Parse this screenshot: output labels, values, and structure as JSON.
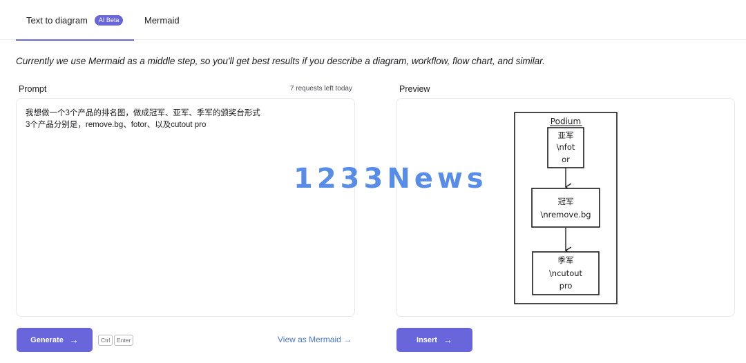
{
  "tabs": {
    "text_to_diagram": "Text to diagram",
    "ai_badge": "AI Beta",
    "mermaid": "Mermaid"
  },
  "description": "Currently we use Mermaid as a middle step, so you'll get best results if you describe a diagram, workflow, flow chart, and similar.",
  "prompt": {
    "label": "Prompt",
    "requests_left": "7 requests left today",
    "lines": [
      "我想做一个3个产品的排名图，做成冠军、亚军、季军的颁奖台形式",
      "3个产品分别是，remove.bg、fotor、以及cutout pro"
    ]
  },
  "preview": {
    "label": "Preview",
    "diagram": {
      "container_title": "Podium",
      "nodes": [
        {
          "lines": [
            "亚军",
            "\\nfot",
            "or"
          ]
        },
        {
          "lines": [
            "冠军",
            "\\nremove.bg"
          ]
        },
        {
          "lines": [
            "季军",
            "\\ncutout",
            "pro"
          ]
        }
      ]
    }
  },
  "actions": {
    "generate_label": "Generate",
    "generate_arrow": "→",
    "kbd_ctrl": "Ctrl",
    "kbd_enter": "Enter",
    "view_mermaid_label": "View as Mermaid →",
    "insert_label": "Insert",
    "insert_arrow": "→"
  },
  "watermark": "1233News",
  "colors": {
    "accent": "#6965db",
    "link": "#4a76d1",
    "watermark": "#4f86e8"
  }
}
